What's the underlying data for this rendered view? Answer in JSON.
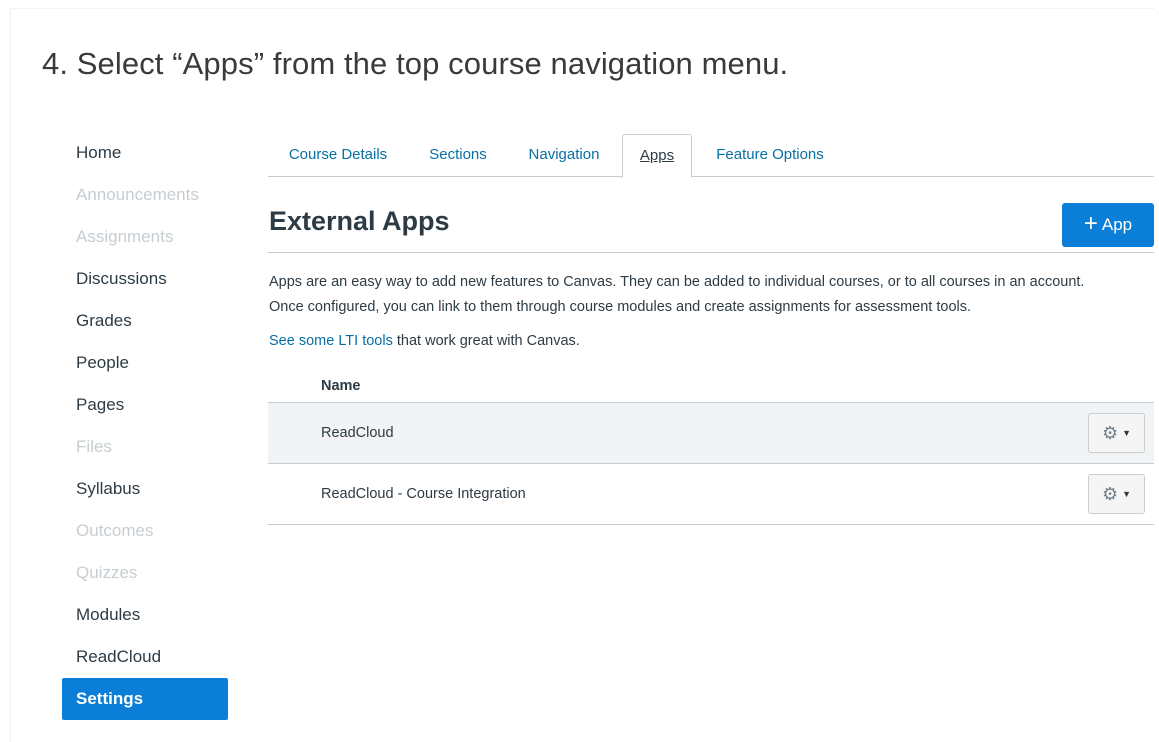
{
  "instruction": "4. Select “Apps” from the top course navigation menu.",
  "sidebar": {
    "items": [
      {
        "label": "Home",
        "state": "enabled"
      },
      {
        "label": "Announcements",
        "state": "disabled"
      },
      {
        "label": "Assignments",
        "state": "disabled"
      },
      {
        "label": "Discussions",
        "state": "enabled"
      },
      {
        "label": "Grades",
        "state": "enabled"
      },
      {
        "label": "People",
        "state": "enabled"
      },
      {
        "label": "Pages",
        "state": "enabled"
      },
      {
        "label": "Files",
        "state": "disabled"
      },
      {
        "label": "Syllabus",
        "state": "enabled"
      },
      {
        "label": "Outcomes",
        "state": "disabled"
      },
      {
        "label": "Quizzes",
        "state": "disabled"
      },
      {
        "label": "Modules",
        "state": "enabled"
      },
      {
        "label": "ReadCloud",
        "state": "enabled"
      },
      {
        "label": "Settings",
        "state": "active"
      }
    ]
  },
  "tabs": [
    {
      "label": "Course Details"
    },
    {
      "label": "Sections"
    },
    {
      "label": "Navigation"
    },
    {
      "label": "Apps",
      "active": true
    },
    {
      "label": "Feature Options"
    }
  ],
  "main": {
    "title": "External Apps",
    "add_button_label": "App",
    "add_button_icon": "plus-icon",
    "description_line1": "Apps are an easy way to add new features to Canvas. They can be added to individual courses, or to all courses in an account.",
    "description_line2": "Once configured, you can link to them through course modules and create assignments for assessment tools.",
    "lti_link_text": "See some LTI tools",
    "lti_suffix": " that work great with Canvas.",
    "table_header_name": "Name",
    "rows": [
      {
        "name": "ReadCloud"
      },
      {
        "name": "ReadCloud - Course Integration"
      }
    ],
    "row_action_icon": "gear-icon"
  },
  "colors": {
    "accent": "#0b7ed8",
    "link": "#0770a3",
    "text": "#2d3b45",
    "disabled": "#c7cdd1"
  }
}
